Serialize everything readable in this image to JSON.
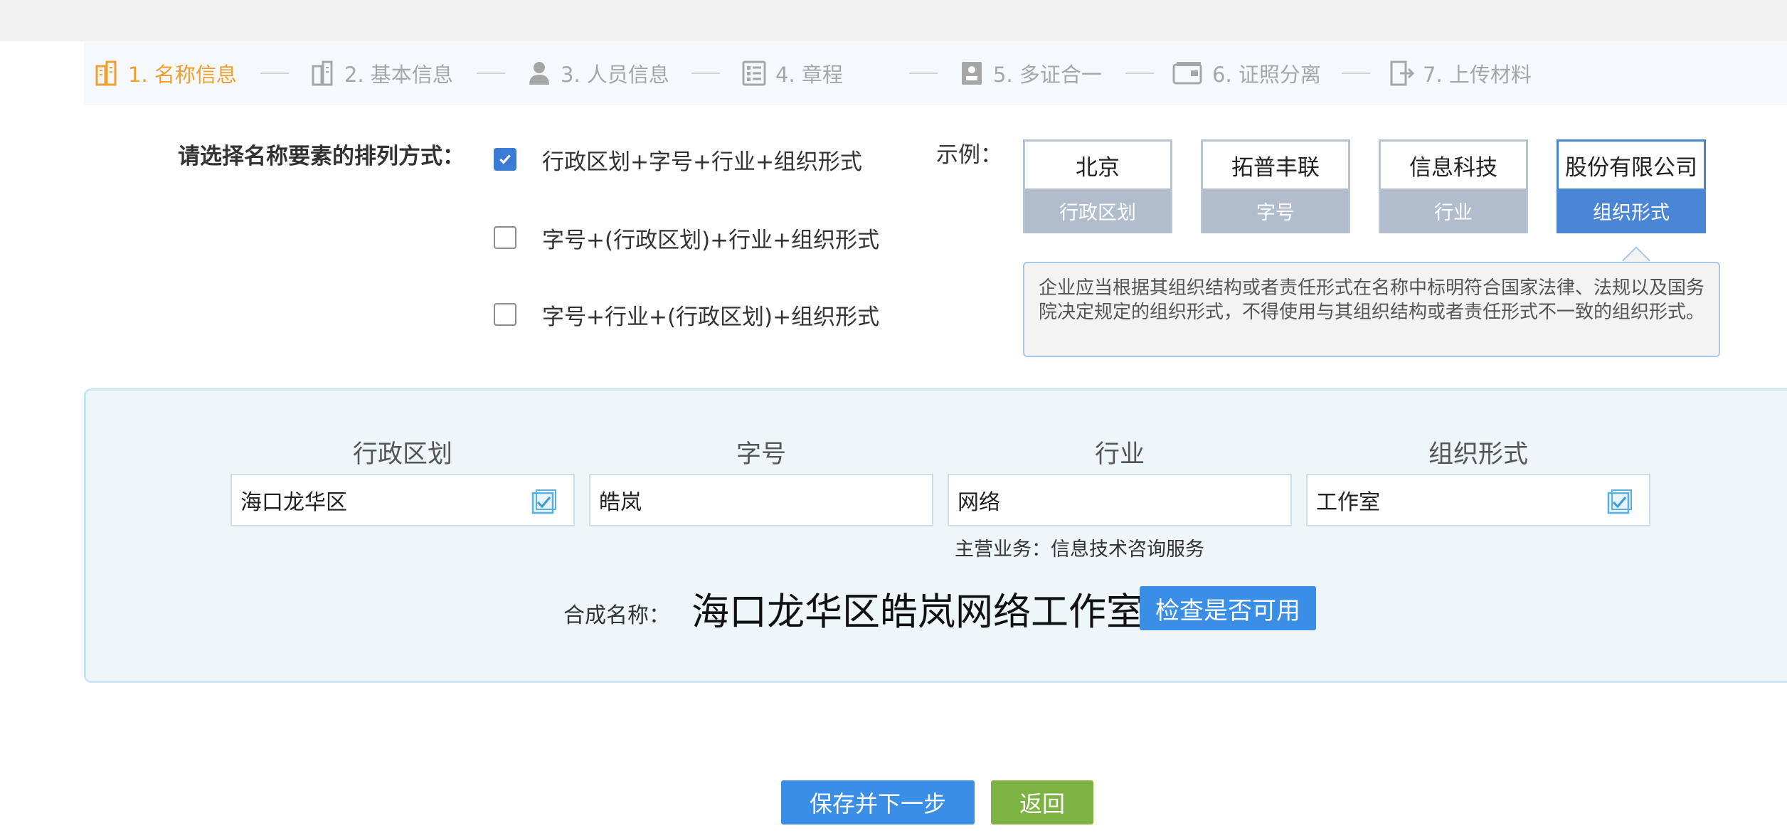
{
  "steps": [
    {
      "label": "1. 名称信息",
      "icon": "building-icon",
      "active": true
    },
    {
      "label": "2. 基本信息",
      "icon": "building-icon"
    },
    {
      "label": "3. 人员信息",
      "icon": "person-icon"
    },
    {
      "label": "4. 章程",
      "icon": "list-icon"
    },
    {
      "label": "5. 多证合一",
      "icon": "id-card-icon"
    },
    {
      "label": "6. 证照分离",
      "icon": "card-icon"
    },
    {
      "label": "7. 上传材料",
      "icon": "upload-door-icon"
    }
  ],
  "selection": {
    "label": "请选择名称要素的排列方式：",
    "options": [
      {
        "label": "行政区划+字号+行业+组织形式",
        "checked": true
      },
      {
        "label": "字号+(行政区划)+行业+组织形式",
        "checked": false
      },
      {
        "label": "字号+行业+(行政区划)+组织形式",
        "checked": false
      }
    ]
  },
  "example": {
    "label": "示例：",
    "cards": [
      {
        "value": "北京",
        "caption": "行政区划"
      },
      {
        "value": "拓普丰联",
        "caption": "字号"
      },
      {
        "value": "信息科技",
        "caption": "行业"
      },
      {
        "value": "股份有限公司",
        "caption": "组织形式",
        "active": true
      }
    ],
    "tip": "企业应当根据其组织结构或者责任形式在名称中标明符合国家法律、法规以及国务院决定规定的组织形式，不得使用与其组织结构或者责任形式不一致的组织形式。"
  },
  "compose": {
    "columns": [
      {
        "header": "行政区划",
        "value": "海口龙华区"
      },
      {
        "header": "字号",
        "value": "皓岚"
      },
      {
        "header": "行业",
        "value": "网络"
      },
      {
        "header": "组织形式",
        "value": "工作室"
      }
    ],
    "business": "主营业务：信息技术咨询服务",
    "combined_label": "合成名称：",
    "combined_name": "海口龙华区皓岚网络工作室",
    "check_button": "检查是否可用"
  },
  "buttons": {
    "save": "保存并下一步",
    "back": "返回"
  },
  "colors": {
    "active_step": "#f0a030",
    "primary": "#3a8ee6",
    "back": "#7cb342",
    "panel_bg": "#eef6f8"
  }
}
